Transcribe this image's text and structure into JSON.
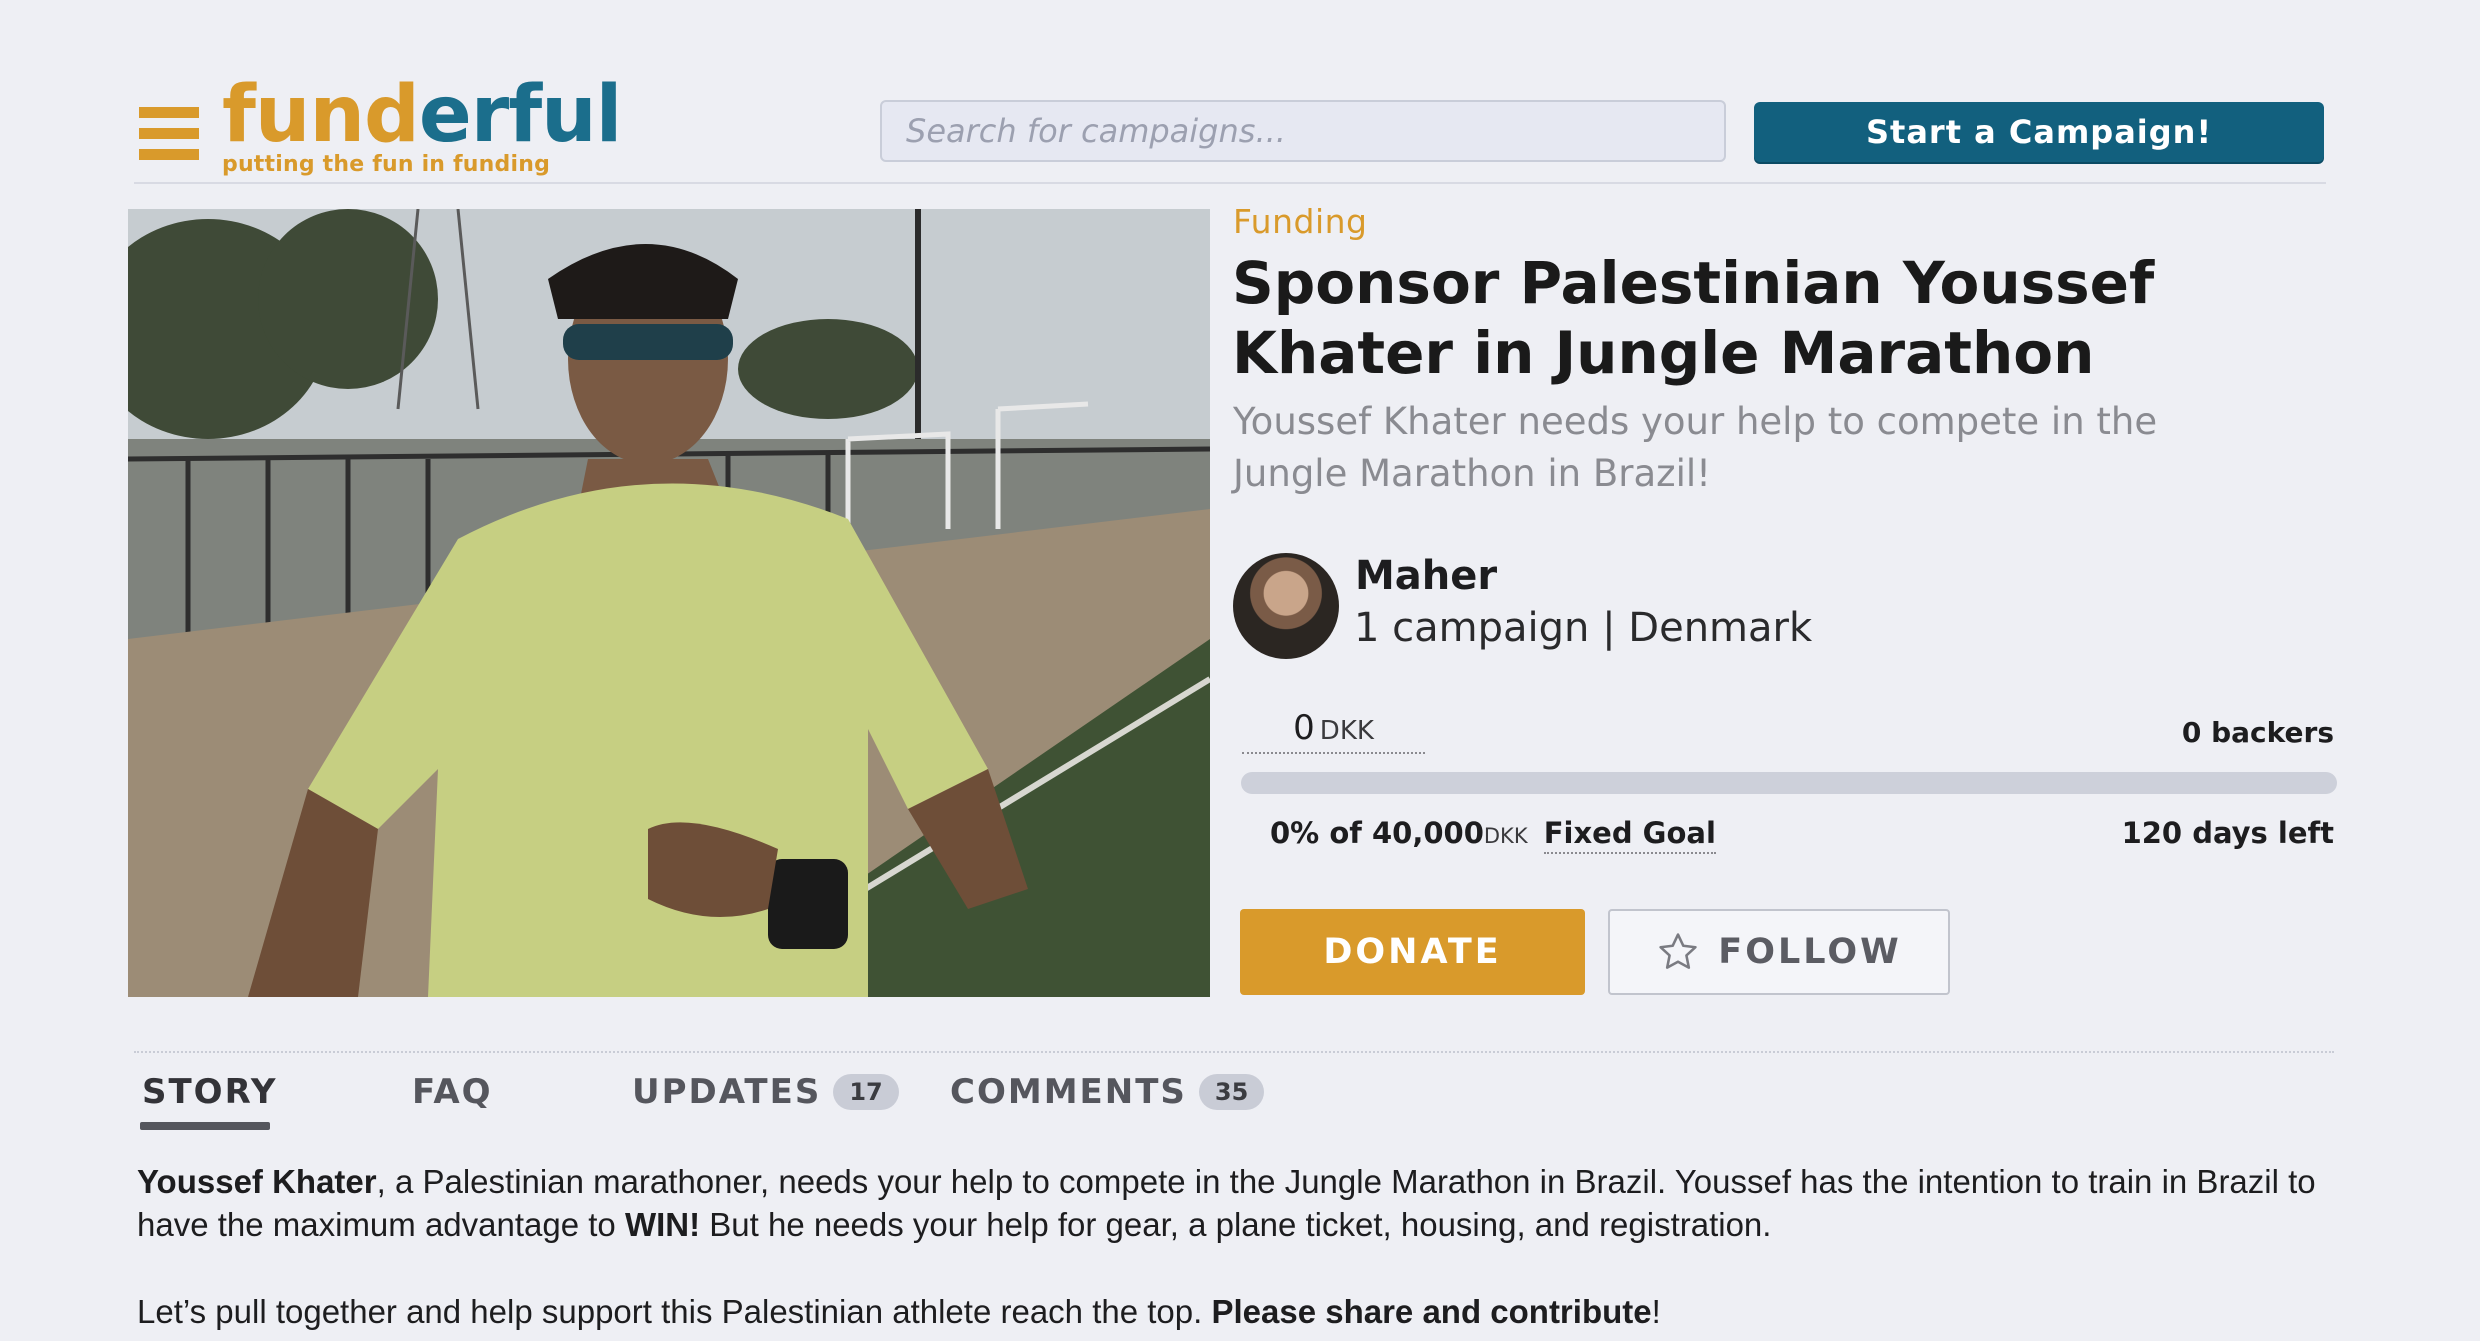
{
  "header": {
    "logo": {
      "part1": "fund",
      "part2": "erful",
      "tagline": "putting the fun in funding"
    },
    "search_placeholder": "Search for campaigns...",
    "start_campaign_label": "Start a Campaign!"
  },
  "campaign": {
    "status_label": "Funding",
    "title": "Sponsor Palestinian Youssef Khater in Jungle Marathon",
    "subtitle": "Youssef Khater needs your help to compete in the Jungle Marathon in Brazil!",
    "creator": {
      "name": "Maher",
      "meta": "1 campaign | Denmark"
    },
    "raised": {
      "amount": "0",
      "currency": "DKK"
    },
    "backers": "0 backers",
    "progress_percent": 0,
    "goal": {
      "percent_text": "0% of 40,000",
      "currency": "DKK",
      "type": "Fixed Goal"
    },
    "days_left": "120 days left",
    "donate_label": "DONATE",
    "follow_label": "FOLLOW"
  },
  "tabs": [
    {
      "label": "STORY",
      "active": true
    },
    {
      "label": "FAQ"
    },
    {
      "label": "UPDATES",
      "count": "17"
    },
    {
      "label": "COMMENTS",
      "count": "35"
    }
  ],
  "story": {
    "p1": {
      "name": "Youssef Khater",
      "text1": ", a Palestinian marathoner, needs your help to compete in the Jungle Marathon in Brazil. Youssef has the intention to train in Brazil to have the maximum advantage to ",
      "win": "WIN!",
      "text2": " But he needs your help for gear, a plane ticket, housing, and registration."
    },
    "p2": {
      "text1": "Let’s pull together and help support this Palestinian athlete reach the top. ",
      "bold": "Please share and contribute",
      "text2": "!"
    }
  },
  "colors": {
    "accent": "#d99a2b",
    "brand_blue": "#12607e",
    "logo_blue": "#1b6e8c"
  },
  "icons": [
    "menu-icon",
    "star-icon"
  ]
}
